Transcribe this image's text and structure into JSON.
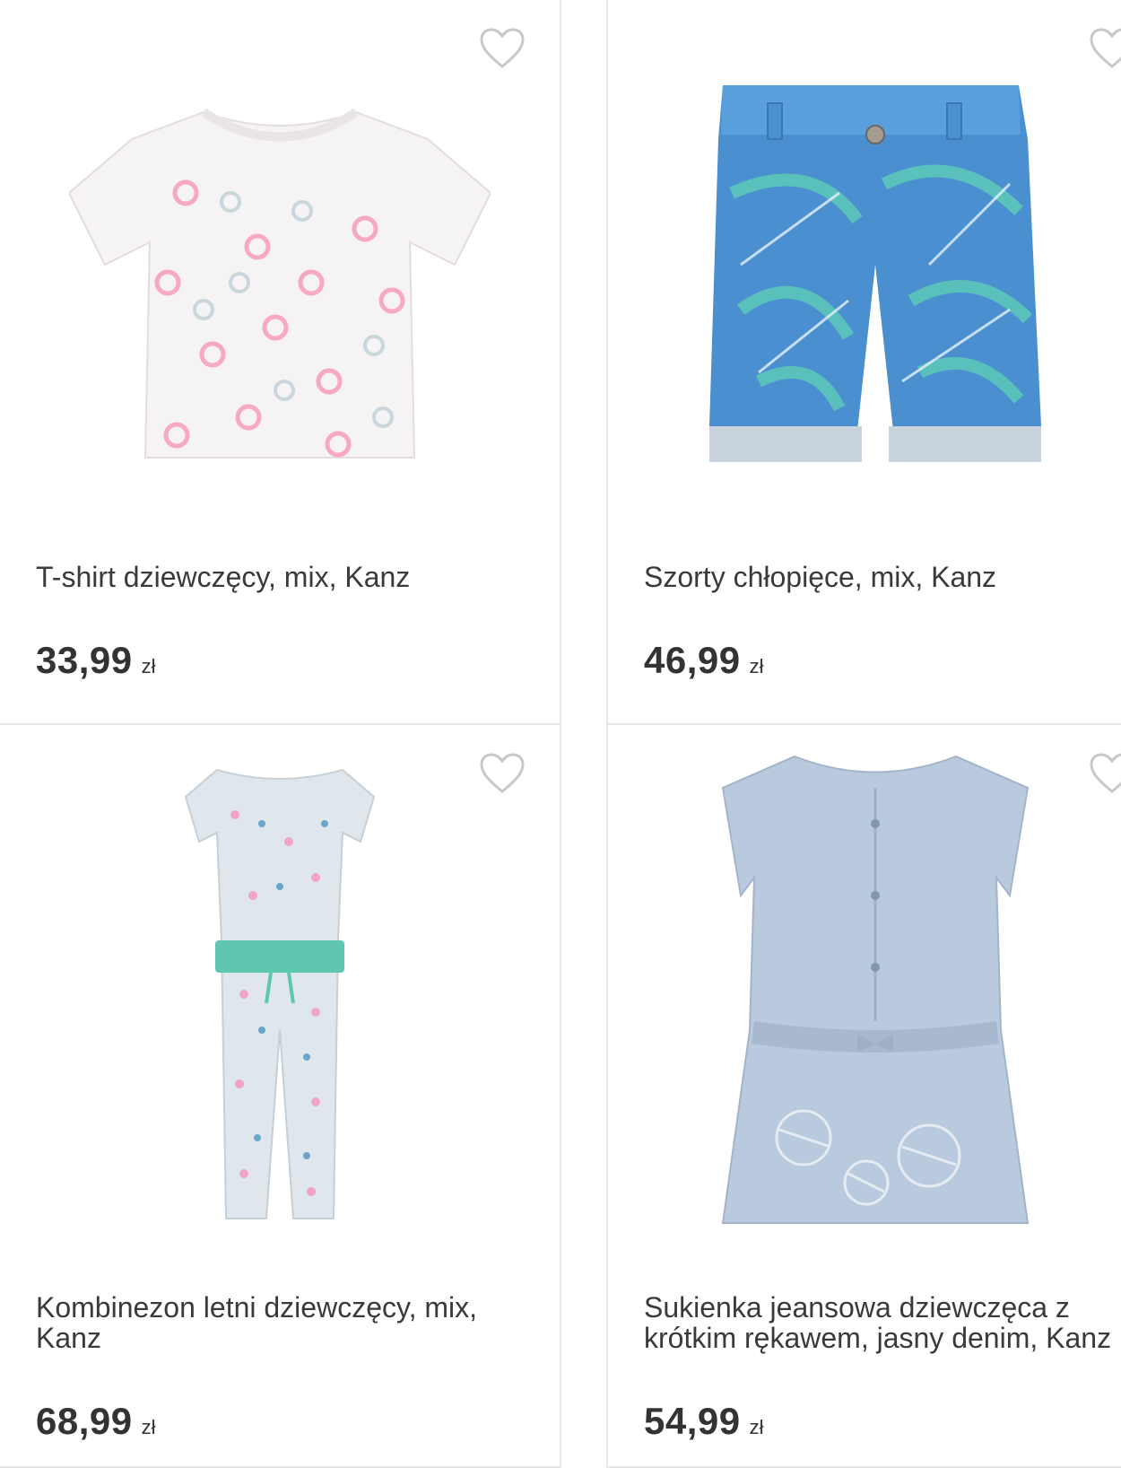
{
  "products": [
    {
      "name": "T-shirt dziewczęcy, mix, Kanz",
      "price": "33,99",
      "currency": "zł",
      "image_icon": "tshirt-image",
      "favorite_icon": "heart-outline-icon"
    },
    {
      "name": "Szorty chłopięce, mix, Kanz",
      "price": "46,99",
      "currency": "zł",
      "image_icon": "shorts-image",
      "favorite_icon": "heart-outline-icon"
    },
    {
      "name": "Kombinezon letni dziewczęcy, mix, Kanz",
      "price": "68,99",
      "currency": "zł",
      "image_icon": "jumpsuit-image",
      "favorite_icon": "heart-outline-icon"
    },
    {
      "name": "Sukienka jeansowa dziewczęca z krótkim rękawem, jasny denim, Kanz",
      "price": "54,99",
      "currency": "zł",
      "image_icon": "dress-image",
      "favorite_icon": "heart-outline-icon"
    }
  ],
  "colors": {
    "border": "#e6e6e6",
    "text": "#333333",
    "heart": "#c8c8c8",
    "tshirt_pink": "#f7a8c4",
    "shorts_blue": "#4a8fd0",
    "shorts_teal": "#5cc6b9",
    "jumpsuit_belt": "#5fc6b0",
    "dress_denim": "#b9c9de"
  }
}
